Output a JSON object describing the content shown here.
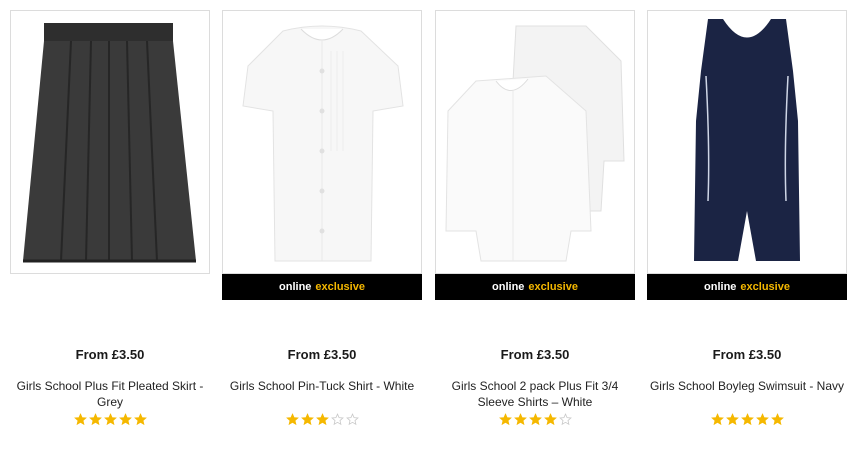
{
  "products": [
    {
      "price": "From £3.50",
      "title_line1": "Girls School Plus Fit Pleated Skirt -",
      "title_line2": "Grey",
      "rating": 5,
      "online_exclusive": false,
      "image": "grey-pleated-skirt"
    },
    {
      "price": "From £3.50",
      "title_line1": "Girls School Pin-Tuck Shirt - White",
      "title_line2": "",
      "rating": 3,
      "online_exclusive": true,
      "image": "white-pin-tuck-shirt"
    },
    {
      "price": "From £3.50",
      "title_line1": "Girls School 2 pack Plus Fit 3/4",
      "title_line2": "Sleeve Shirts – White",
      "rating": 4,
      "online_exclusive": true,
      "image": "two-white-shirts"
    },
    {
      "price": "From £3.50",
      "title_line1": "Girls School Boyleg Swimsuit - Navy",
      "title_line2": "",
      "rating": 5,
      "online_exclusive": true,
      "image": "navy-boyleg-swimsuit"
    }
  ],
  "badge": {
    "online": "online",
    "exclusive": "exclusive"
  },
  "colors": {
    "star_filled": "#f5b800",
    "star_empty": "#c8c8c8",
    "exclusive_text": "#f5b800"
  }
}
